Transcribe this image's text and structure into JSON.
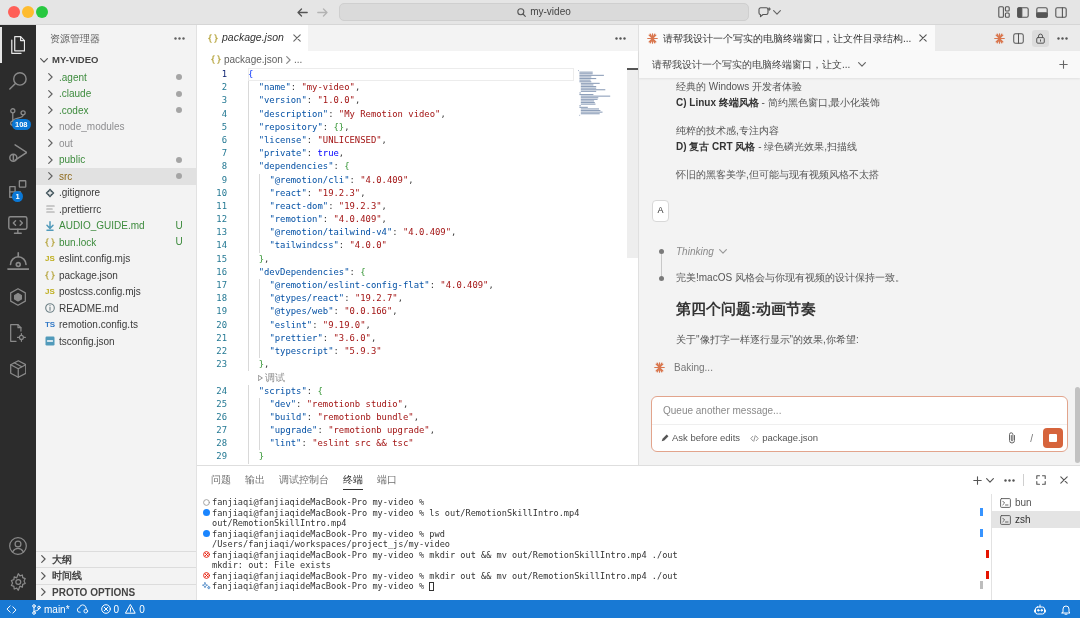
{
  "title_bar": {
    "search": "my-video"
  },
  "activity_bar": {
    "items": [
      {
        "kind": "explorer",
        "selected": true
      },
      {
        "kind": "search",
        "selected": false
      },
      {
        "kind": "source-control",
        "selected": false,
        "badge": "108"
      },
      {
        "kind": "run-debug",
        "selected": false
      },
      {
        "kind": "extensions",
        "selected": false,
        "badge": "1"
      },
      {
        "kind": "remote",
        "selected": false
      },
      {
        "kind": "arc",
        "selected": false
      },
      {
        "kind": "hexagon",
        "selected": false
      },
      {
        "kind": "doc-gear",
        "selected": false
      },
      {
        "kind": "package",
        "selected": false
      }
    ],
    "bottom": [
      {
        "kind": "account"
      },
      {
        "kind": "settings"
      }
    ]
  },
  "explorer": {
    "title": "资源管理器",
    "tree": {
      "label": "MY-VIDEO",
      "expanded": true,
      "children": [
        {
          "kind": "folder",
          "label": ".agent",
          "expanded": false,
          "selected": false,
          "untracked": true,
          "modified": false,
          "ignored": false,
          "dot": true
        },
        {
          "kind": "folder",
          "label": ".claude",
          "expanded": false,
          "selected": false,
          "untracked": true,
          "modified": false,
          "ignored": false,
          "dot": true
        },
        {
          "kind": "folder",
          "label": ".codex",
          "expanded": false,
          "selected": false,
          "untracked": true,
          "modified": false,
          "ignored": false,
          "dot": true
        },
        {
          "kind": "folder",
          "label": "node_modules",
          "expanded": false,
          "selected": false,
          "untracked": false,
          "modified": false,
          "ignored": true,
          "dot": false
        },
        {
          "kind": "folder",
          "label": "out",
          "expanded": false,
          "selected": false,
          "untracked": false,
          "modified": false,
          "ignored": true,
          "dot": false
        },
        {
          "kind": "folder",
          "label": "public",
          "expanded": false,
          "selected": false,
          "untracked": true,
          "modified": false,
          "ignored": false,
          "dot": true
        },
        {
          "kind": "folder",
          "label": "src",
          "expanded": false,
          "selected": true,
          "untracked": false,
          "modified": true,
          "ignored": false,
          "dot": true
        },
        {
          "kind": "gitignore",
          "label": ".gitignore",
          "selected": false,
          "untracked": false,
          "modified": false,
          "ignored": false
        },
        {
          "kind": "text",
          "label": ".prettierrc",
          "selected": false,
          "untracked": false,
          "modified": false,
          "ignored": false
        },
        {
          "kind": "markdown",
          "label": "AUDIO_GUIDE.md",
          "selected": false,
          "untracked": true,
          "modified": false,
          "ignored": false,
          "badge": "U"
        },
        {
          "kind": "json",
          "label": "bun.lock",
          "selected": false,
          "untracked": true,
          "modified": false,
          "ignored": false,
          "badge": "U"
        },
        {
          "kind": "js",
          "glyph": "JS",
          "label": "eslint.config.mjs",
          "selected": false,
          "untracked": false,
          "modified": false,
          "ignored": false
        },
        {
          "kind": "json",
          "label": "package.json",
          "selected": false,
          "untracked": false,
          "modified": false,
          "ignored": false
        },
        {
          "kind": "js",
          "glyph": "JS",
          "label": "postcss.config.mjs",
          "selected": false,
          "untracked": false,
          "modified": false,
          "ignored": false
        },
        {
          "kind": "readme",
          "label": "README.md",
          "selected": false,
          "untracked": false,
          "modified": false,
          "ignored": false
        },
        {
          "kind": "ts",
          "glyph": "TS",
          "label": "remotion.config.ts",
          "selected": false,
          "untracked": false,
          "modified": false,
          "ignored": false
        },
        {
          "kind": "tsconfig",
          "label": "tsconfig.json",
          "selected": false,
          "untracked": false,
          "modified": false,
          "ignored": false
        }
      ]
    },
    "sections": [
      {
        "label": "大纲",
        "expanded": false
      },
      {
        "label": "时间线",
        "expanded": false
      },
      {
        "label": "PROTO OPTIONS",
        "expanded": false
      }
    ]
  },
  "editor": {
    "tabs": [
      {
        "label": "package.json",
        "selected": true,
        "preview": true
      }
    ],
    "breadcrumb": [
      "package.json",
      "..."
    ],
    "lines": [
      {
        "kind": "code",
        "number": "1",
        "text": "{",
        "current": true
      },
      {
        "kind": "code",
        "number": "2",
        "text": "  \"name\": \"my-video\",",
        "current": false
      },
      {
        "kind": "code",
        "number": "3",
        "text": "  \"version\": \"1.0.0\",",
        "current": false
      },
      {
        "kind": "code",
        "number": "4",
        "text": "  \"description\": \"My Remotion video\",",
        "current": false
      },
      {
        "kind": "code",
        "number": "5",
        "text": "  \"repository\": {},",
        "current": false
      },
      {
        "kind": "code",
        "number": "6",
        "text": "  \"license\": \"UNLICENSED\",",
        "current": false
      },
      {
        "kind": "code",
        "number": "7",
        "text": "  \"private\": true,",
        "current": false
      },
      {
        "kind": "code",
        "number": "8",
        "text": "  \"dependencies\": {",
        "current": false
      },
      {
        "kind": "code",
        "number": "9",
        "text": "    \"@remotion/cli\": \"4.0.409\",",
        "current": false
      },
      {
        "kind": "code",
        "number": "10",
        "text": "    \"react\": \"19.2.3\",",
        "current": false
      },
      {
        "kind": "code",
        "number": "11",
        "text": "    \"react-dom\": \"19.2.3\",",
        "current": false
      },
      {
        "kind": "code",
        "number": "12",
        "text": "    \"remotion\": \"4.0.409\",",
        "current": false
      },
      {
        "kind": "code",
        "number": "13",
        "text": "    \"@remotion/tailwind-v4\": \"4.0.409\",",
        "current": false
      },
      {
        "kind": "code",
        "number": "14",
        "text": "    \"tailwindcss\": \"4.0.0\"",
        "current": false
      },
      {
        "kind": "code",
        "number": "15",
        "text": "  },",
        "current": false
      },
      {
        "kind": "code",
        "number": "16",
        "text": "  \"devDependencies\": {",
        "current": false
      },
      {
        "kind": "code",
        "number": "17",
        "text": "    \"@remotion/eslint-config-flat\": \"4.0.409\",",
        "current": false
      },
      {
        "kind": "code",
        "number": "18",
        "text": "    \"@types/react\": \"19.2.7\",",
        "current": false
      },
      {
        "kind": "code",
        "number": "19",
        "text": "    \"@types/web\": \"0.0.166\",",
        "current": false
      },
      {
        "kind": "code",
        "number": "20",
        "text": "    \"eslint\": \"9.19.0\",",
        "current": false
      },
      {
        "kind": "code",
        "number": "21",
        "text": "    \"prettier\": \"3.6.0\",",
        "current": false
      },
      {
        "kind": "code",
        "number": "22",
        "text": "    \"typescript\": \"5.9.3\"",
        "current": false
      },
      {
        "kind": "code",
        "number": "23",
        "text": "  },",
        "current": false
      },
      {
        "kind": "codelens",
        "text": "调试"
      },
      {
        "kind": "code",
        "number": "24",
        "text": "  \"scripts\": {",
        "current": false
      },
      {
        "kind": "code",
        "number": "25",
        "text": "    \"dev\": \"remotionb studio\",",
        "current": false
      },
      {
        "kind": "code",
        "number": "26",
        "text": "    \"build\": \"remotionb bundle\",",
        "current": false
      },
      {
        "kind": "code",
        "number": "27",
        "text": "    \"upgrade\": \"remotionb upgrade\",",
        "current": false
      },
      {
        "kind": "code",
        "number": "28",
        "text": "    \"lint\": \"eslint src && tsc\"",
        "current": false
      },
      {
        "kind": "code",
        "number": "29",
        "text": "  }",
        "current": false
      }
    ]
  },
  "chat": {
    "tabs": [
      {
        "title": "请帮我设计一个写实的电脑终端窗口，让文件目录结构...",
        "selected": true
      }
    ],
    "session": "请帮我设计一个写实的电脑终端窗口，让文...",
    "blocks": [
      {
        "kind": "paragraph",
        "lines": [
          "经典的 Windows 开发者体验",
          "**C) Linux 终端风格** - 简约黑色窗口,最小化装饰"
        ]
      },
      {
        "kind": "paragraph",
        "lines": [
          "纯粹的技术感,专注内容",
          "**D) 复古 CRT 风格** - 绿色磷光效果,扫描线"
        ]
      },
      {
        "kind": "paragraph",
        "lines": [
          "怀旧的黑客美学,但可能与现有视频风格不太搭"
        ]
      },
      {
        "kind": "user",
        "text": "A"
      },
      {
        "kind": "thinking",
        "text": "Thinking",
        "expanded": false
      },
      {
        "kind": "step",
        "text": "完美!macOS 风格会与你现有视频的设计保持一致。"
      },
      {
        "kind": "heading",
        "text": "第四个问题:动画节奏"
      },
      {
        "kind": "paragraph",
        "lines": [
          "关于\"像打字一样逐行显示\"的效果,你希望:"
        ]
      },
      {
        "kind": "status",
        "text": "Baking..."
      }
    ],
    "input": {
      "placeholder": "Queue another message...",
      "mode": "Ask before edits",
      "context": "package.json",
      "command": "/"
    }
  },
  "panel": {
    "tabs": [
      {
        "label": "问题",
        "selected": false
      },
      {
        "label": "输出",
        "selected": false
      },
      {
        "label": "调试控制台",
        "selected": false
      },
      {
        "label": "终端",
        "selected": true
      },
      {
        "label": "端口",
        "selected": false
      }
    ],
    "lines": [
      {
        "kind": "idle",
        "text": "fanjiaqi@fanjiaqideMacBook-Pro my-video %",
        "cursor": false
      },
      {
        "kind": "success",
        "text": "fanjiaqi@fanjiaqideMacBook-Pro my-video % ls out/RemotionSkillIntro.mp4",
        "cursor": false
      },
      {
        "kind": "output",
        "text": "out/RemotionSkillIntro.mp4"
      },
      {
        "kind": "success",
        "text": "fanjiaqi@fanjiaqideMacBook-Pro my-video % pwd",
        "cursor": false
      },
      {
        "kind": "output",
        "text": "/Users/fanjiaqi/workspaces/project_js/my-video"
      },
      {
        "kind": "error",
        "text": "fanjiaqi@fanjiaqideMacBook-Pro my-video % mkdir out && mv out/RemotionSkillIntro.mp4 ./out",
        "cursor": false
      },
      {
        "kind": "output",
        "text": "mkdir: out: File exists"
      },
      {
        "kind": "error",
        "text": "fanjiaqi@fanjiaqideMacBook-Pro my-video % mkdir out && mv out/RemotionSkillIntro.mp4 ./out",
        "cursor": false
      },
      {
        "kind": "active",
        "text": "fanjiaqi@fanjiaqideMacBook-Pro my-video %",
        "cursor": true
      }
    ],
    "terminals": [
      {
        "label": "bun",
        "selected": false
      },
      {
        "label": "zsh",
        "selected": true
      }
    ]
  },
  "status_bar": {
    "branch": "main*",
    "errors": "0",
    "warnings": "0"
  }
}
